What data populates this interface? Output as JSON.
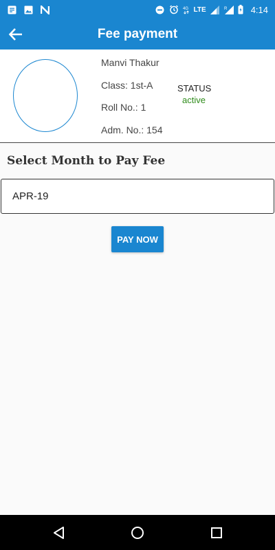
{
  "status_bar": {
    "time": "4:14",
    "network_label": "LTE",
    "icons": [
      "notification-icon",
      "image-icon",
      "n-icon",
      "do-not-disturb-icon",
      "alarm-icon",
      "4g-icon",
      "signal-icon",
      "roaming-signal-icon",
      "battery-icon"
    ]
  },
  "app_bar": {
    "title": "Fee payment",
    "back_icon": "arrow-back-icon"
  },
  "profile": {
    "name": "Manvi  Thakur",
    "class": "Class: 1st-A",
    "roll": "Roll No.: 1",
    "adm": "Adm. No.: 154",
    "status_label": "STATUS",
    "status_value": "active"
  },
  "fee": {
    "section_title": "Select Month to Pay Fee",
    "selected_month": "APR-19",
    "pay_button": "PAY NOW"
  },
  "colors": {
    "primary": "#1a86d0",
    "active": "#2e8b1a"
  },
  "nav": {
    "icons": [
      "back-triangle-icon",
      "home-circle-icon",
      "recents-square-icon"
    ]
  }
}
